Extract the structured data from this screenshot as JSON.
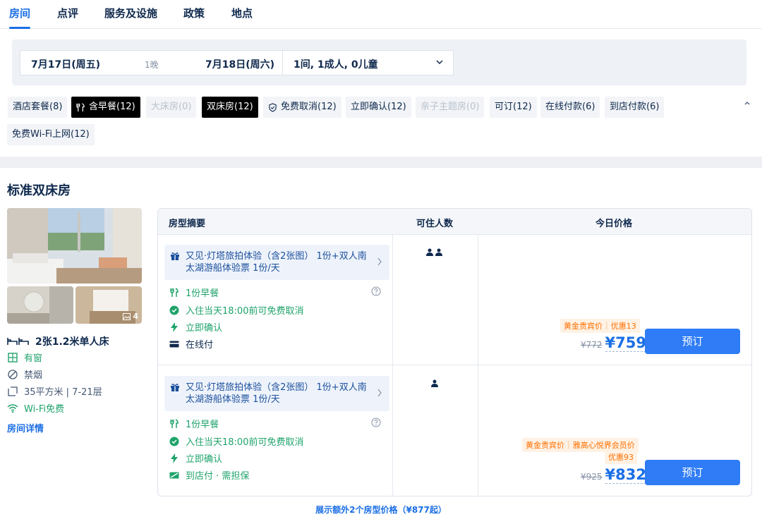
{
  "tabs": [
    {
      "label": "房间",
      "active": true
    },
    {
      "label": "点评"
    },
    {
      "label": "服务及设施"
    },
    {
      "label": "政策"
    },
    {
      "label": "地点"
    }
  ],
  "search": {
    "checkin": "7月17日(周五)",
    "nights": "1晚",
    "checkout": "7月18日(周六)",
    "guests": "1间, 1成人, 0儿童"
  },
  "filters": [
    {
      "label": "酒店套餐(8)",
      "state": "normal"
    },
    {
      "label": "含早餐(12)",
      "state": "selected",
      "icon": "utensils-icon"
    },
    {
      "label": "大床房(0)",
      "state": "disabled"
    },
    {
      "label": "双床房(12)",
      "state": "selected"
    },
    {
      "label": "免费取消(12)",
      "state": "normal",
      "icon": "shield-icon"
    },
    {
      "label": "立即确认(12)",
      "state": "normal"
    },
    {
      "label": "亲子主题房(0)",
      "state": "disabled"
    },
    {
      "label": "可订(12)",
      "state": "normal"
    },
    {
      "label": "在线付款(6)",
      "state": "normal"
    },
    {
      "label": "到店付款(6)",
      "state": "normal"
    },
    {
      "label": "免费Wi-Fi上网(12)",
      "state": "normal"
    }
  ],
  "room": {
    "title": "标准双床房",
    "photo_count": "4",
    "bed": "2张1.2米单人床",
    "window": "有窗",
    "smoking": "禁烟",
    "size_floor": "35平方米 | 7-21层",
    "wifi": "Wi-Fi免费",
    "detail_link": "房间详情"
  },
  "table": {
    "headers": {
      "summary": "房型摘要",
      "occupancy": "可住人数",
      "price": "今日价格"
    }
  },
  "rates": [
    {
      "package": "又见·灯塔旅拍体验（含2张图） 1份+双人南太湖游船体验票 1份/天",
      "breakfast": "1份早餐",
      "cancel": "入住当天18:00前可免费取消",
      "confirm": "立即确认",
      "payment": "在线付",
      "occupancy": 2,
      "tags": [
        "黄金贵宾价",
        "优惠13"
      ],
      "original_price": "¥772",
      "price": "¥759",
      "book_label": "预订"
    },
    {
      "package": "又见·灯塔旅拍体验（含2张图） 1份+双人南太湖游船体验票 1份/天",
      "breakfast": "1份早餐",
      "cancel": "入住当天18:00前可免费取消",
      "confirm": "立即确认",
      "payment": "到店付 · 需担保",
      "occupancy": 1,
      "tags": [
        "黄金贵宾价",
        "雅高心悦界会员价"
      ],
      "discount": "优惠93",
      "original_price": "¥925",
      "price": "¥832",
      "book_label": "预订"
    }
  ],
  "more_link": "展示额外2个房型价格（¥877起）",
  "colors": {
    "accent": "#1b6fe5",
    "green": "#1fa36b",
    "orange": "#ff6f00",
    "button": "#2f7cf6"
  }
}
